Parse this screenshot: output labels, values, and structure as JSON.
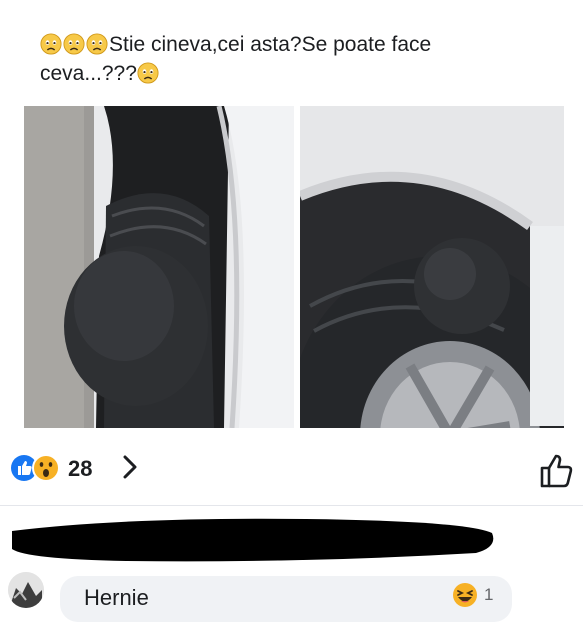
{
  "post": {
    "prefix_emojis": [
      "worried-face-icon",
      "worried-face-icon",
      "worried-face-icon"
    ],
    "text_line1": "Stie cineva,cei asta?Se poate face",
    "text_line2": "ceva...???",
    "suffix_emoji": "worried-face-icon"
  },
  "photos": [
    {
      "subject": "tire-with-sidewall-bulge-left"
    },
    {
      "subject": "tire-with-sidewall-bulge-right"
    }
  ],
  "reactions": {
    "icons": [
      "like-icon",
      "wow-icon"
    ],
    "count": "28"
  },
  "comment": {
    "author_redacted": true,
    "text": "Hernie",
    "reaction_icon": "haha-icon",
    "reaction_count": "1"
  },
  "colors": {
    "like_blue": "#1877f2",
    "reaction_yellow": "#f7b125",
    "comment_bg": "#f0f2f5",
    "text": "#1c1e21",
    "muted": "#65676b"
  }
}
